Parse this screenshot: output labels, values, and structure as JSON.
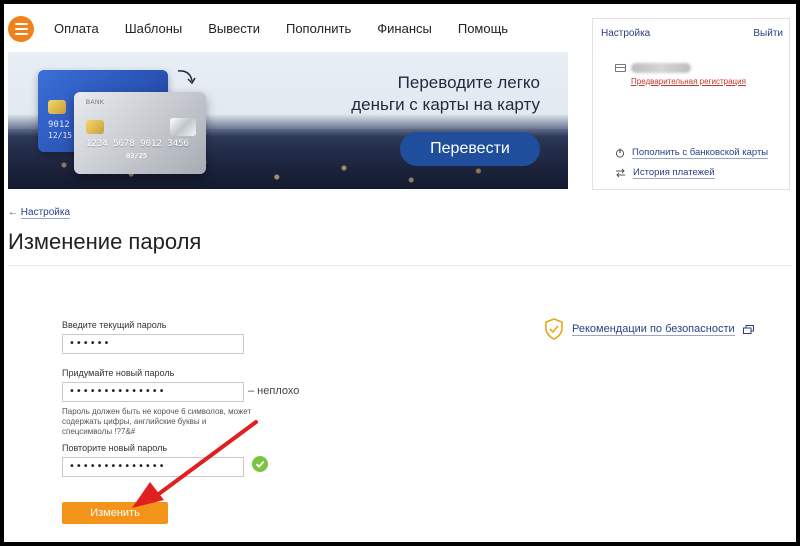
{
  "nav": {
    "items": [
      "Оплата",
      "Шаблоны",
      "Вывести",
      "Пополнить",
      "Финансы",
      "Помощь"
    ]
  },
  "banner": {
    "title_line1": "Переводите легко",
    "title_line2": "деньги с карты на карту",
    "button_label": "Перевести",
    "blue_card_number": "9012",
    "blue_card_date": "12/15",
    "grey_card_bank": "BANK",
    "grey_card_number": "1234 5678 9012 3456",
    "grey_card_exp": "03/25"
  },
  "right_panel": {
    "settings_label": "Настройка",
    "logout_label": "Выйти",
    "registration_label": "Предварительная регистрация",
    "links": [
      "Пополнить с банковской карты",
      "История платежей"
    ]
  },
  "breadcrumb": {
    "label": "Настройка"
  },
  "page": {
    "title": "Изменение пароля"
  },
  "form": {
    "current_label": "Введите текущий пароль",
    "current_value": "••••••",
    "new_label": "Придумайте новый пароль",
    "new_value": "••••••••••••••",
    "strength": "– неплохо",
    "hint": "Пароль должен быть не короче 6 символов, может содержать цифры, английские буквы и спецсимволы !?7&#",
    "repeat_label": "Повторите новый пароль",
    "repeat_value": "••••••••••••••",
    "submit_label": "Изменить"
  },
  "security": {
    "label": "Рекомендации по безопасности"
  },
  "colors": {
    "accent": "#f39318",
    "logo": "#f0821e",
    "link": "#2a3f86",
    "banner_button": "#1f4f9c",
    "success": "#7cc341",
    "annotation_arrow": "#e02020"
  }
}
